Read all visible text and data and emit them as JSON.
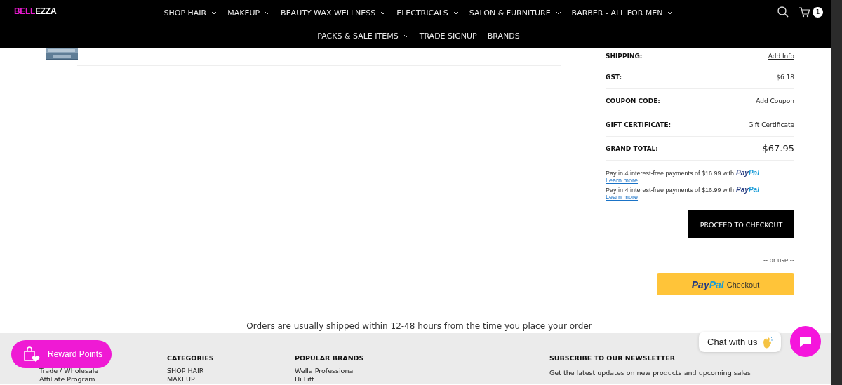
{
  "header": {
    "logo": {
      "accent": "BELL",
      "rest": "EZZA"
    },
    "nav_row_1": [
      {
        "label": "SHOP HAIR",
        "dropdown": true
      },
      {
        "label": "MAKEUP",
        "dropdown": true
      },
      {
        "label": "BEAUTY WAX WELLNESS",
        "dropdown": true
      },
      {
        "label": "ELECTRICALS",
        "dropdown": true
      },
      {
        "label": "SALON & FURNITURE",
        "dropdown": true
      },
      {
        "label": "BARBER - ALL FOR MEN",
        "dropdown": true
      }
    ],
    "nav_row_2": [
      {
        "label": "PACKS & SALE ITEMS",
        "dropdown": true
      },
      {
        "label": "TRADE SIGNUP",
        "dropdown": false
      },
      {
        "label": "BRANDS",
        "dropdown": false
      }
    ],
    "cart_count": "1"
  },
  "summary": {
    "rows": [
      {
        "label": "SHIPPING:",
        "value": "Add Info",
        "kind": "link"
      },
      {
        "label": "GST:",
        "value": "$6.18",
        "kind": "text"
      },
      {
        "label": "COUPON CODE:",
        "value": "Add Coupon",
        "kind": "link"
      },
      {
        "label": "GIFT CERTIFICATE:",
        "value": "Gift Certificate",
        "kind": "link"
      },
      {
        "label": "GRAND TOTAL:",
        "value": "$67.95",
        "kind": "total"
      }
    ],
    "paypal_messages": [
      {
        "text": "Pay in 4 interest-free payments of $16.99 with",
        "brand": "PayPal",
        "link": "Learn more"
      },
      {
        "text": "Pay in 4 interest-free payments of $16.99 with",
        "brand": "PayPal",
        "link": "Learn more"
      }
    ],
    "checkout_button": "PROCEED TO CHECKOUT",
    "or_use": "-- or use --",
    "paypal_button": {
      "brand": "PayPal",
      "label": "Checkout"
    }
  },
  "shipping_note": "Orders are usually shipped within 12-48 hours from the time you place your order",
  "footer": {
    "columns": [
      {
        "links": [
          "Trade / Wholesale",
          "Affiliate Program"
        ]
      },
      {
        "heading": "CATEGORIES",
        "links": [
          "SHOP HAIR",
          "MAKEUP"
        ]
      },
      {
        "heading": "POPULAR BRANDS",
        "links": [
          "Wella Professional",
          "Hi Lift"
        ]
      },
      {
        "heading": "SUBSCRIBE TO OUR NEWSLETTER",
        "links": [
          "Get the latest updates on new products and upcoming sales"
        ]
      }
    ]
  },
  "reward_button": "Reward Points",
  "chat": {
    "label": "Chat with us"
  }
}
